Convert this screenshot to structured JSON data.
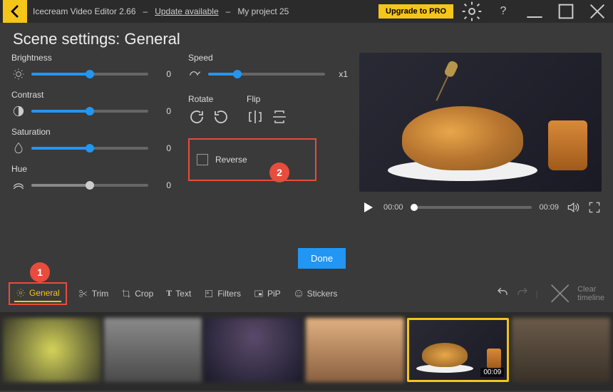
{
  "titlebar": {
    "app_name": "Icecream Video Editor 2.66",
    "update_text": "Update available",
    "project_name": "My project 25",
    "upgrade_label": "Upgrade to PRO"
  },
  "page": {
    "title": "Scene settings: General"
  },
  "sliders": {
    "brightness": {
      "label": "Brightness",
      "value": "0",
      "pct": 50
    },
    "contrast": {
      "label": "Contrast",
      "value": "0",
      "pct": 50
    },
    "saturation": {
      "label": "Saturation",
      "value": "0",
      "pct": 50
    },
    "hue": {
      "label": "Hue",
      "value": "0",
      "pct": 50
    },
    "speed": {
      "label": "Speed",
      "value": "x1",
      "pct": 25
    }
  },
  "rotate": {
    "label": "Rotate"
  },
  "flip": {
    "label": "Flip"
  },
  "reverse": {
    "label": "Reverse",
    "checked": false
  },
  "callouts": {
    "one": "1",
    "two": "2"
  },
  "actions": {
    "done": "Done",
    "clear_timeline": "Clear timeline"
  },
  "tabs": {
    "general": "General",
    "trim": "Trim",
    "crop": "Crop",
    "text": "Text",
    "filters": "Filters",
    "pip": "PiP",
    "stickers": "Stickers"
  },
  "player": {
    "current": "00:00",
    "duration": "00:09"
  },
  "timeline": {
    "selected_duration": "00:09"
  }
}
